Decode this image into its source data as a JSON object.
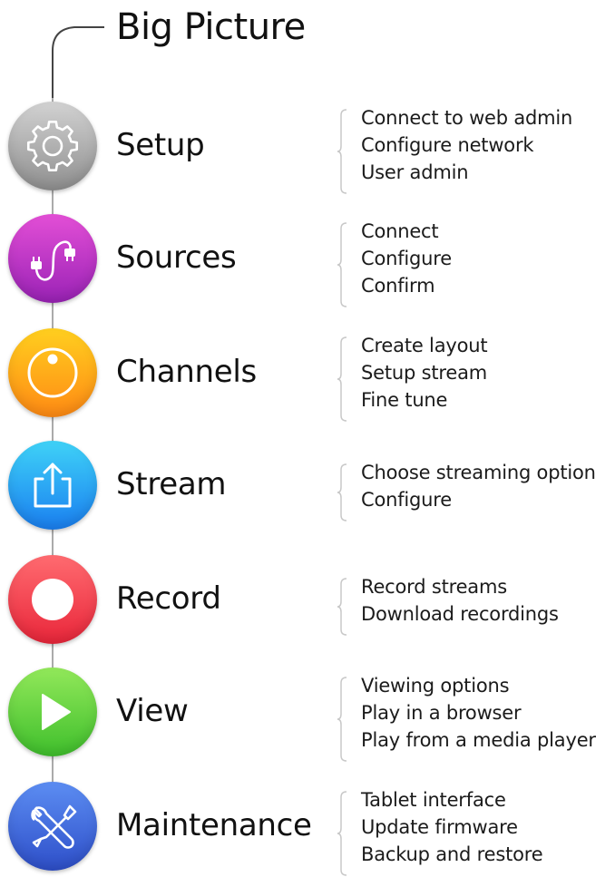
{
  "title": "Big Picture",
  "steps": [
    {
      "label": "Setup",
      "icon": "gear-icon",
      "colors": [
        "#d2d2d2",
        "#8f8f8f"
      ],
      "items": [
        "Connect to web admin",
        "Configure network",
        "User admin"
      ]
    },
    {
      "label": "Sources",
      "icon": "cable-plug-icon",
      "colors": [
        "#e34fd6",
        "#9a22b6"
      ],
      "items": [
        "Connect",
        "Configure",
        "Confirm"
      ]
    },
    {
      "label": "Channels",
      "icon": "dial-icon",
      "colors": [
        "#ffcf1f",
        "#ff8a14"
      ],
      "items": [
        "Create layout",
        "Setup stream",
        "Fine tune"
      ]
    },
    {
      "label": "Stream",
      "icon": "share-upload-icon",
      "colors": [
        "#3fd2f7",
        "#1a7ff0"
      ],
      "items": [
        "Choose streaming option",
        "Configure"
      ]
    },
    {
      "label": "Record",
      "icon": "record-dot-icon",
      "colors": [
        "#ff6b70",
        "#e9263a"
      ],
      "items": [
        "Record streams",
        "Download recordings"
      ]
    },
    {
      "label": "View",
      "icon": "play-icon",
      "colors": [
        "#92e85a",
        "#3fbf2c"
      ],
      "items": [
        "Viewing options",
        "Play in a browser",
        "Play from a media player"
      ]
    },
    {
      "label": "Maintenance",
      "icon": "wrench-screwdriver-icon",
      "colors": [
        "#5c8df2",
        "#2e4fc9"
      ],
      "items": [
        "Tablet interface",
        "Update firmware",
        "Backup and restore"
      ]
    }
  ]
}
